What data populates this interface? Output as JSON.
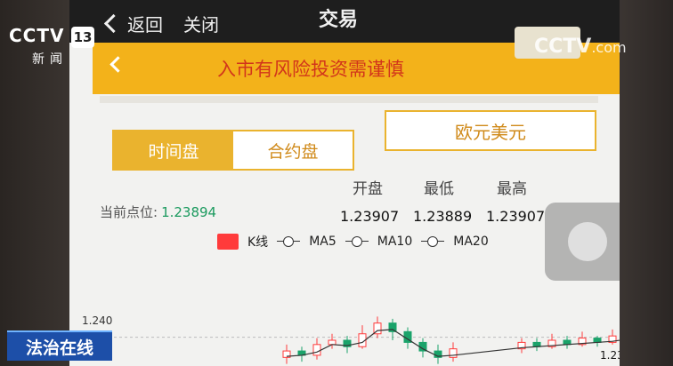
{
  "topbar": {
    "back_label": "返回",
    "close_label": "关闭",
    "title": "交易"
  },
  "banner": {
    "title": "入市有风险投资需谨慎"
  },
  "tabs": [
    {
      "label": "时间盘",
      "active": true
    },
    {
      "label": "合约盘",
      "active": false
    }
  ],
  "currency_label": "欧元美元",
  "current_point": {
    "label": "当前点位:",
    "value": "1.23894"
  },
  "quote": {
    "columns": [
      {
        "header": "开盘",
        "value": "1.23907"
      },
      {
        "header": "最低",
        "value": "1.23889"
      },
      {
        "header": "最高",
        "value": "1.23907"
      }
    ]
  },
  "legend": {
    "k_label": "K线",
    "items": [
      "MA5",
      "MA10",
      "MA20"
    ]
  },
  "chart": {
    "y_top_tick": "1.240",
    "last_price": "1.23894",
    "candles": [
      {
        "o": 1.238,
        "c": 1.2383,
        "h": 1.2386,
        "l": 1.2377
      },
      {
        "o": 1.2383,
        "c": 1.2381,
        "h": 1.2385,
        "l": 1.2378
      },
      {
        "o": 1.2381,
        "c": 1.2386,
        "h": 1.2389,
        "l": 1.2379
      },
      {
        "o": 1.2386,
        "c": 1.2388,
        "h": 1.2391,
        "l": 1.2384
      },
      {
        "o": 1.2388,
        "c": 1.2385,
        "h": 1.239,
        "l": 1.2382
      },
      {
        "o": 1.2385,
        "c": 1.2391,
        "h": 1.2395,
        "l": 1.2384
      },
      {
        "o": 1.2391,
        "c": 1.2396,
        "h": 1.2399,
        "l": 1.2389
      },
      {
        "o": 1.2396,
        "c": 1.2392,
        "h": 1.2398,
        "l": 1.2388
      },
      {
        "o": 1.2392,
        "c": 1.2387,
        "h": 1.2394,
        "l": 1.2384
      },
      {
        "o": 1.2387,
        "c": 1.2383,
        "h": 1.2389,
        "l": 1.238
      },
      {
        "o": 1.2383,
        "c": 1.238,
        "h": 1.2386,
        "l": 1.2377
      },
      {
        "o": 1.238,
        "c": 1.2384,
        "h": 1.2387,
        "l": 1.2378
      },
      {
        "o": 1.2384,
        "c": 1.2387,
        "h": 1.2389,
        "l": 1.2382
      },
      {
        "o": 1.2387,
        "c": 1.2385,
        "h": 1.2389,
        "l": 1.2383
      },
      {
        "o": 1.2385,
        "c": 1.2388,
        "h": 1.2391,
        "l": 1.2384
      },
      {
        "o": 1.2388,
        "c": 1.2386,
        "h": 1.239,
        "l": 1.2384
      },
      {
        "o": 1.2386,
        "c": 1.2389,
        "h": 1.2392,
        "l": 1.2385
      },
      {
        "o": 1.2389,
        "c": 1.2387,
        "h": 1.239,
        "l": 1.2385
      },
      {
        "o": 1.2387,
        "c": 1.239,
        "h": 1.2393,
        "l": 1.2386
      },
      {
        "o": 1.239,
        "c": 1.2389,
        "h": 1.2392,
        "l": 1.2387
      }
    ]
  },
  "overlay": {
    "channel_logo": "CCTV",
    "channel_number": "13",
    "channel_sub": "新闻",
    "watermark": "CCTV",
    "watermark_suffix": ".com",
    "program_name": "法治在线"
  },
  "colors": {
    "accent": "#eab32e",
    "banner": "#f3b21a",
    "up": "#ff3b3b",
    "down": "#1aa36a"
  }
}
